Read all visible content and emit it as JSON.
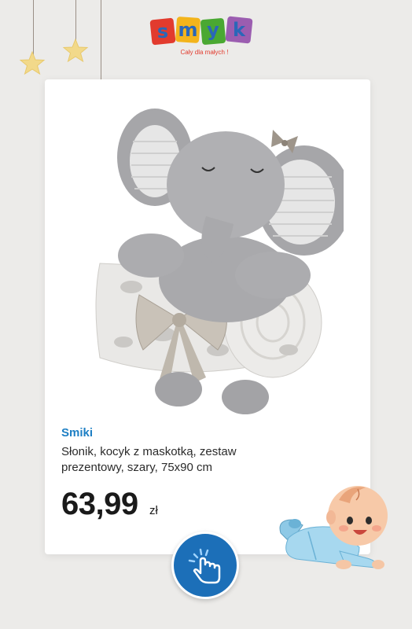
{
  "logo": {
    "letters": [
      "s",
      "m",
      "y",
      "k"
    ],
    "tagline": "Cały dla małych !",
    "colors": [
      "#e23b2e",
      "#f3b41b",
      "#4aa832",
      "#2a67b8",
      "#9b5db0"
    ]
  },
  "product": {
    "brand": "Smiki",
    "name": "Słonik, kocyk z maskotką, zestaw prezentowy, szary, 75x90 cm",
    "price": "63,99",
    "currency": "zł"
  },
  "colors": {
    "brand_blue": "#1d7fc4",
    "button_blue": "#1c6fb8",
    "star": "#f2d98a",
    "background": "#ecebe9"
  },
  "icons": [
    "star-icon",
    "tap-hand-icon"
  ]
}
